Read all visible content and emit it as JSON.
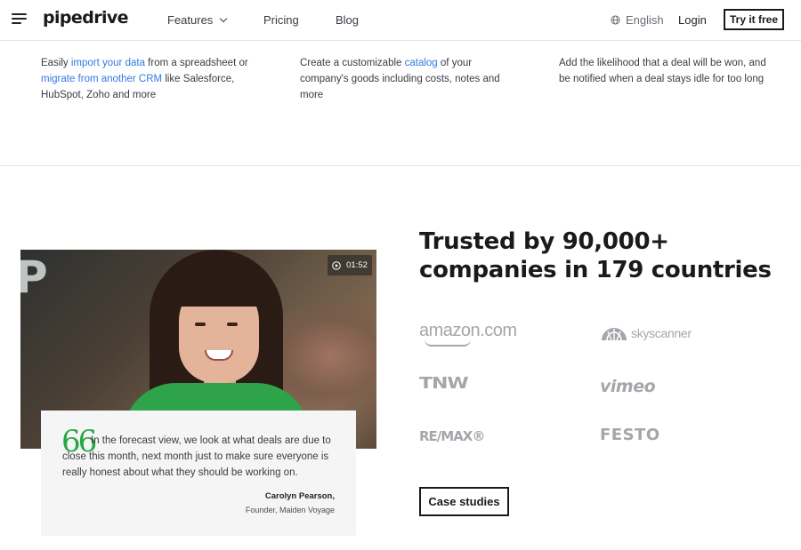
{
  "header": {
    "logo": "pipedrive",
    "nav": {
      "features": "Features",
      "pricing": "Pricing",
      "blog": "Blog"
    },
    "language": "English",
    "login": "Login",
    "cta": "Try it free"
  },
  "features": [
    {
      "parts": [
        "Easily ",
        "import your data",
        " from a spreadsheet or ",
        "migrate from another CRM",
        " like Salesforce, HubSpot, Zoho and more"
      ]
    },
    {
      "parts": [
        "Create a customizable ",
        "catalog",
        " of your company's goods including costs, notes and more"
      ]
    },
    {
      "parts": [
        "Add the likelihood that a deal will be won, and be notified when a deal stays idle for too long"
      ]
    }
  ],
  "video": {
    "duration": "01:52",
    "logo_letter": "P"
  },
  "testimonial": {
    "quote_mark": "66",
    "text": "In the forecast view, we look at what deals are due to close this month, next month just to make sure everyone is really honest about what they should be working on.",
    "author": "Carolyn Pearson,",
    "role": "Founder, Maiden Voyage"
  },
  "trusted": {
    "title": "Trusted by 90,000+ companies in 179 countries",
    "logos": {
      "amazon": "amazon.com",
      "skyscanner": "skyscanner",
      "tnw": "TNW",
      "vimeo": "vimeo",
      "remax": "RE/MAX®",
      "festo": "FESTO"
    },
    "case_studies": "Case studies"
  },
  "colors": {
    "link": "#317ae2",
    "quote_accent": "#28a745",
    "logo_gray": "#a4a6ab",
    "text_dark": "#1a1a1a"
  },
  "icons": {
    "menu": "hamburger-menu-icon",
    "features_dropdown": "chevron-down-icon",
    "language": "globe-icon",
    "video": "play-icon"
  }
}
